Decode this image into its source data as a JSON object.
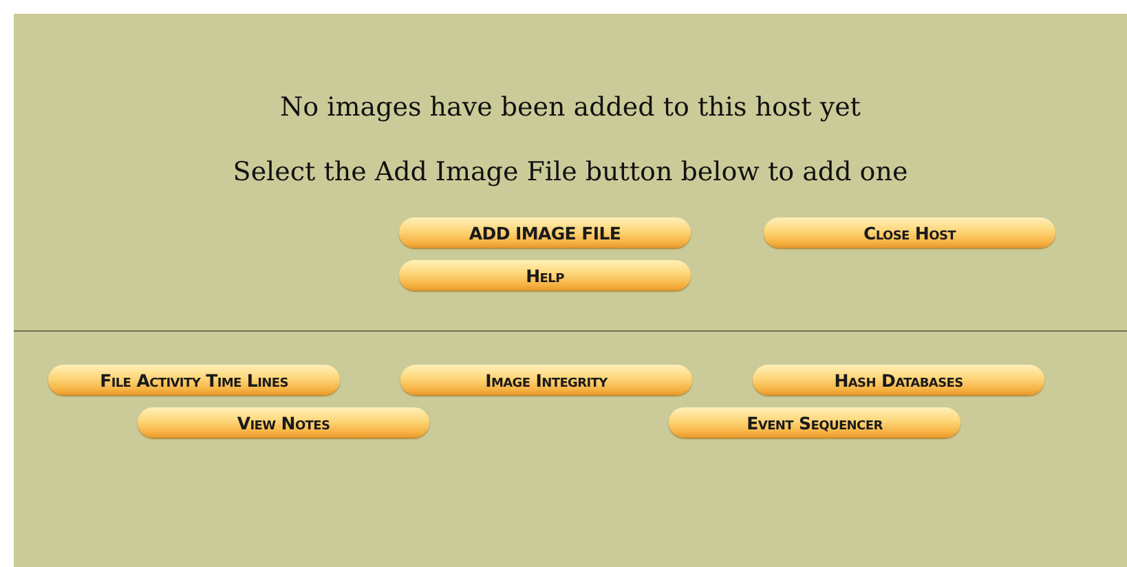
{
  "messages": [
    "No images have been added to this host yet",
    "Select the Add Image File button below to add one"
  ],
  "host_buttons": [
    [
      "ADD IMAGE FILE",
      "Close Host"
    ],
    [
      "Help"
    ]
  ],
  "tool_buttons": [
    [
      "File Activity Time Lines",
      "Image Integrity",
      "Hash Databases"
    ],
    [
      "View Notes",
      "Event Sequencer"
    ]
  ]
}
